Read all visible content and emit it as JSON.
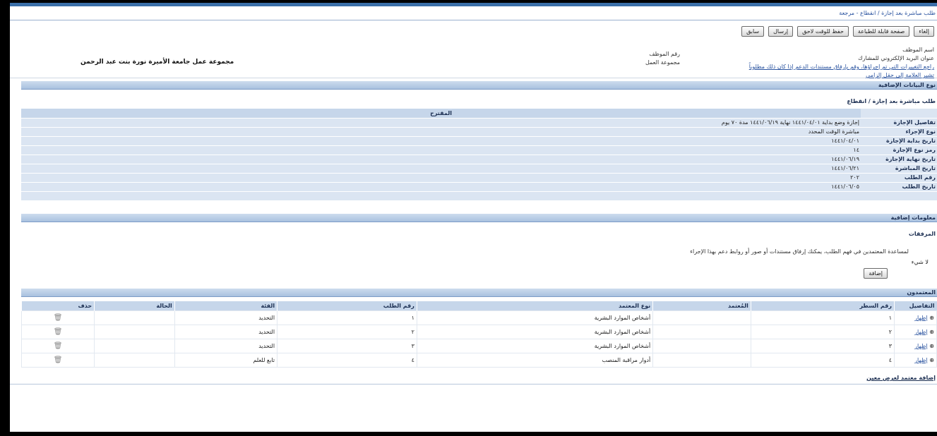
{
  "breadcrumb": "طلب مباشرة بعد إجازة / انقطاع - مرجعة",
  "buttons": {
    "back": "إلغاء",
    "printable_page": "صفحة قابلة للطباعة",
    "save_for_later": "حفظ للوقت لاحق",
    "submit": "إرسال",
    "return": "سابق"
  },
  "header": {
    "employee_name_label": "اسم الموظف",
    "email_label": "عنوان البريد الإلكتروني للمشارك",
    "review_notice": "راجع التغييرات التي تم إجراؤها، وقم بإرفاق مستندات الدعم إذا كان ذلك مطلوباً",
    "required_notice": "تشير العلامة إلى حقل إلزامي",
    "employee_number_label": "رقم الموظف",
    "work_group_label": "مجموعة العمل",
    "work_group_value": "مجموعة عمل جامعة الأميرة نورة بنت عبد الرحمن"
  },
  "sections": {
    "extra_data_type": "نوع البيانات الإضافية",
    "request_title": "طلب مباشرة بعد إجازة / انقطاع",
    "additional_info": "معلومات إضافية",
    "attachments": "المرفقات",
    "approvers": "المعتمدون"
  },
  "proposed_header": "المقترح",
  "details": [
    {
      "label": "تفاصيل الإجازة",
      "value": "إجازة وضع بداية ١٤٤١/٠٤/٠١ نهاية ١٤٤١/٠٦/١٩ مدة ٧٠ يوم"
    },
    {
      "label": "نوع الإجراء",
      "value": "مباشرة الوقت المحدد"
    },
    {
      "label": "تاريخ بداية الإجازة",
      "value": "١٤٤١/٠٤/٠١"
    },
    {
      "label": "رمز نوع الإجازة",
      "value": "١٤"
    },
    {
      "label": "تاريخ نهاية الإجازة",
      "value": "١٤٤١/٠٦/١٩"
    },
    {
      "label": "تاريخ المباشرة",
      "value": "١٤٤١/٠٦/٢١"
    },
    {
      "label": "رقم الطلب",
      "value": "٢٠٢"
    },
    {
      "label": "تاريخ الطلب",
      "value": "١٤٤١/٠٦/٠٥"
    }
  ],
  "attachments": {
    "notice": "لمساعدة المعتمدين في فهم الطلب، يمكنك إرفاق مستندات أو صور أو روابط دعم بهذا الإجراء",
    "no_results": "لا شيء",
    "add_button": "إضافة"
  },
  "approvers_table": {
    "columns": [
      "التفاصيل",
      "رقم السطر",
      "المُعتمد",
      "نوع المعتمد",
      "رقم الطلب",
      "الفئة",
      "الحالة",
      "حذف"
    ],
    "details_link": "إظهار",
    "rows": [
      {
        "line": "١",
        "approver": "",
        "type": "أشخاص الموارد البشرية",
        "request_no": "١",
        "category": "التحديد",
        "status": ""
      },
      {
        "line": "٢",
        "approver": "",
        "type": "أشخاص الموارد البشرية",
        "request_no": "٢",
        "category": "التحديد",
        "status": ""
      },
      {
        "line": "٣",
        "approver": "",
        "type": "أشخاص الموارد البشرية",
        "request_no": "٣",
        "category": "التحديد",
        "status": ""
      },
      {
        "line": "٤",
        "approver": "",
        "type": "أدوار مراقبة المنصب",
        "request_no": "٤",
        "category": "تابع للعلم",
        "status": ""
      }
    ]
  },
  "add_approver_link": "إضافة معتمد لغرض معين"
}
